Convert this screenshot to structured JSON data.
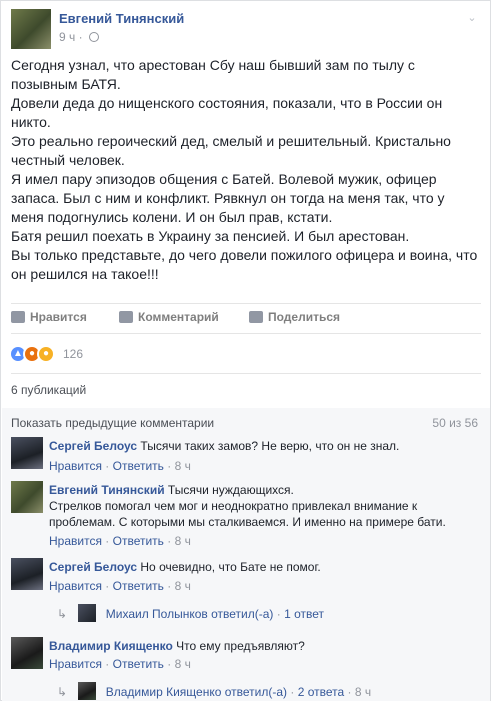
{
  "post": {
    "author": "Евгений Тинянский",
    "time": "9 ч",
    "paragraphs": [
      "Сегодня узнал, что арестован Сбу наш бывший зам по тылу с позывным БАТЯ.",
      "Довели деда до нищенского состояния, показали, что в России он никто.",
      "Это реально героический дед, смелый и решительный. Кристально честный человек.",
      "Я имел пару эпизодов общения с Батей. Волевой мужик, офицер запаса. Был с ним и конфликт. Рявкнул он тогда на меня так, что у меня подогнулись колени. И он был прав, кстати.",
      "Батя решил поехать в Украину за пенсией. И был арестован.",
      "Вы только представьте, до чего довели пожилого офицера и воина, что он решился на такое!!!"
    ]
  },
  "actions": {
    "like": "Нравится",
    "comment": "Комментарий",
    "share": "Поделиться"
  },
  "reactions": {
    "icons": [
      "like-icon",
      "angry-icon",
      "sad-icon"
    ],
    "count": "126"
  },
  "shares": "6 публикаций",
  "comments_header": {
    "show_previous": "Показать предыдущие комментарии",
    "counter": "50 из 56"
  },
  "comment_meta": {
    "like": "Нравится",
    "separator": "·",
    "reply": "Ответить"
  },
  "comments": [
    {
      "name": "Сергей Белоус",
      "text": "Тысячи таких замов? Не верю, что он не знал.",
      "time": "8 ч"
    },
    {
      "name": "Евгений Тинянский",
      "text": "Тысячи нуждающихся.",
      "text2": "Стрелков помогал чем мог и неоднократно привлекал внимание к проблемам. С которыми мы сталкиваемся. И именно на примере бати.",
      "time": "8 ч"
    },
    {
      "name": "Сергей Белоус",
      "text": "Но очевидно, что Бате не помог.",
      "time": "8 ч"
    },
    {
      "name": "Владимир Киященко",
      "text": "Что ему предъявляют?",
      "time": "8 ч"
    }
  ],
  "replies": [
    {
      "name": "Михаил Полынков",
      "verb": "ответил(-а)",
      "count": "1 ответ"
    },
    {
      "name": "Владимир Киященко",
      "verb": "ответил(-а)",
      "count": "2 ответа",
      "time": "8 ч"
    }
  ]
}
